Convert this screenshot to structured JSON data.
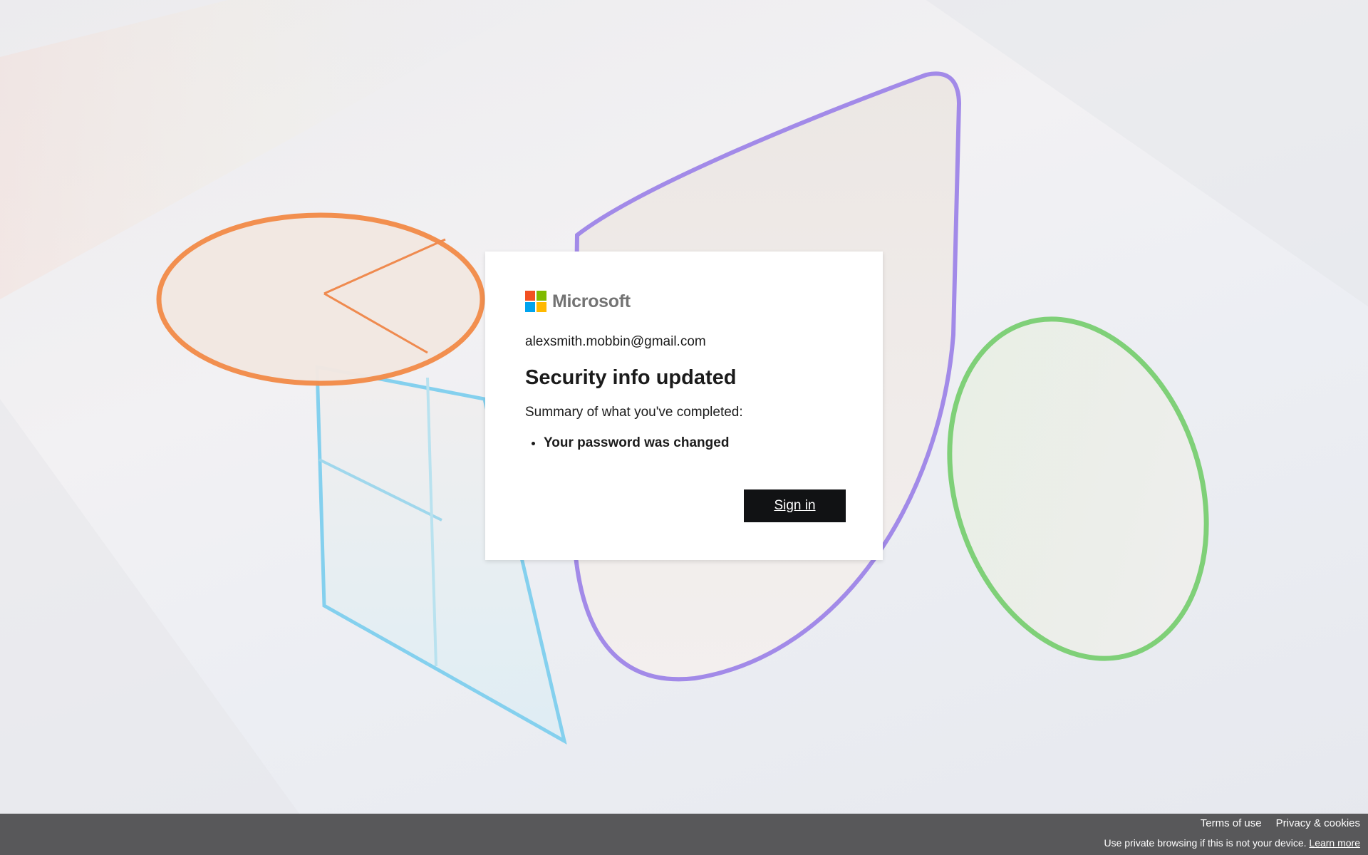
{
  "logo": {
    "text": "Microsoft",
    "colors": [
      "#f25022",
      "#7fba00",
      "#00a4ef",
      "#ffb900"
    ]
  },
  "card": {
    "email": "alexsmith.mobbin@gmail.com",
    "title": "Security info updated",
    "summary": "Summary of what you've completed:",
    "completed_items": [
      "Your password was changed"
    ],
    "sign_in_label": "Sign in"
  },
  "footer": {
    "terms_label": "Terms of use",
    "privacy_label": "Privacy & cookies",
    "note": "Use private browsing if this is not your device.",
    "learn_more_label": "Learn more"
  },
  "colors": {
    "button_bg": "#111214",
    "footer_bg": "#58585a"
  }
}
